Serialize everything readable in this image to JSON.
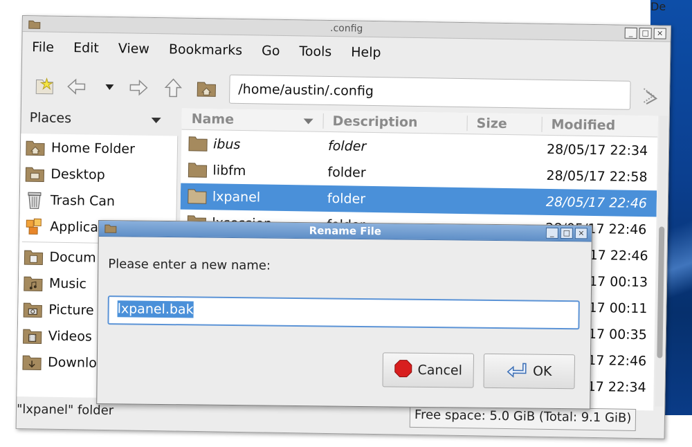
{
  "window": {
    "title": ".config",
    "controls": [
      "_",
      "□",
      "×"
    ]
  },
  "menu": [
    "File",
    "Edit",
    "View",
    "Bookmarks",
    "Go",
    "Tools",
    "Help"
  ],
  "toolbar": {
    "address": "/home/austin/.config"
  },
  "sidebar": {
    "header": "Places",
    "items": [
      {
        "label": "Home Folder",
        "icon": "home-folder-icon"
      },
      {
        "label": "Desktop",
        "icon": "desktop-folder-icon"
      },
      {
        "label": "Trash Can",
        "icon": "trash-icon"
      },
      {
        "label": "Applica",
        "icon": "applications-icon"
      },
      {
        "label": "Docum",
        "icon": "documents-folder-icon"
      },
      {
        "label": "Music",
        "icon": "music-folder-icon"
      },
      {
        "label": "Picture",
        "icon": "pictures-folder-icon"
      },
      {
        "label": "Videos",
        "icon": "videos-folder-icon"
      },
      {
        "label": "Downlo",
        "icon": "downloads-folder-icon"
      }
    ]
  },
  "columns": {
    "name": "Name",
    "description": "Description",
    "size": "Size",
    "modified": "Modified"
  },
  "files": [
    {
      "name": "ibus",
      "description": "folder",
      "modified": "28/05/17 22:34"
    },
    {
      "name": "libfm",
      "description": "folder",
      "modified": "28/05/17 22:58"
    },
    {
      "name": "lxpanel",
      "description": "folder",
      "modified": "28/05/17 22:46"
    },
    {
      "name": "lxsession",
      "description": "folder",
      "modified": "28/05/17 22:46"
    },
    {
      "name": "",
      "description": "",
      "modified": "17 22:46"
    },
    {
      "name": "",
      "description": "",
      "modified": "17 00:13"
    },
    {
      "name": "",
      "description": "",
      "modified": "17 00:11"
    },
    {
      "name": "",
      "description": "",
      "modified": "17 00:35"
    },
    {
      "name": "",
      "description": "",
      "modified": "17 22:46"
    },
    {
      "name": "",
      "description": "",
      "modified": "17 22:34"
    }
  ],
  "status": {
    "selection": "\"lxpanel\" folder",
    "free_space": "Free space: 5.0 GiB (Total: 9.1 GiB)"
  },
  "dialog": {
    "title": "Rename File",
    "prompt": "Please enter a new name:",
    "value": "lxpanel.bak",
    "cancel_label": "Cancel",
    "ok_label": "OK"
  },
  "desktop_text": "De",
  "colors": {
    "selection": "#4a90d9",
    "dialog_titlebar": "#5f8fc7",
    "desktop": "#0b3f8f"
  }
}
